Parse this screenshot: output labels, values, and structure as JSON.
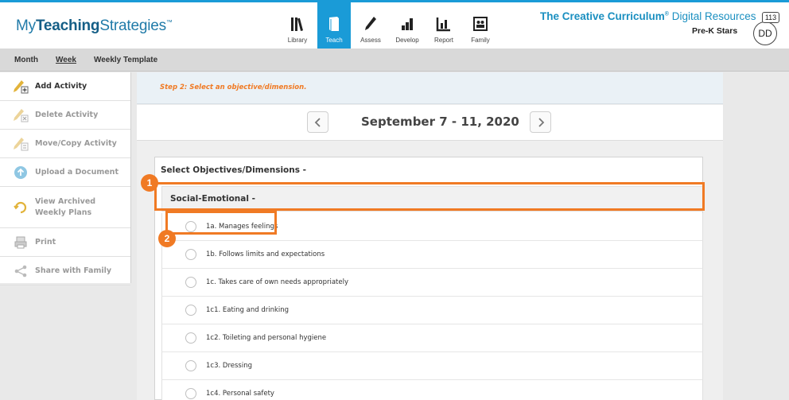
{
  "header": {
    "logo_prefix": "My",
    "logo_bold": "Teaching",
    "logo_suffix": "Strategies",
    "logo_tm": "™",
    "nav": [
      {
        "label": "Library",
        "icon": "library-icon"
      },
      {
        "label": "Teach",
        "icon": "teach-icon"
      },
      {
        "label": "Assess",
        "icon": "assess-icon"
      },
      {
        "label": "Develop",
        "icon": "develop-icon"
      },
      {
        "label": "Report",
        "icon": "report-icon"
      },
      {
        "label": "Family",
        "icon": "family-icon"
      }
    ],
    "active_nav": "Teach",
    "brand_bold": "The Creative Curriculum",
    "brand_reg": "®",
    "brand_light": " Digital Resources",
    "class_name": "Pre-K Stars",
    "avatar_initials": "DD",
    "notification_count": "113"
  },
  "subnav": {
    "items": [
      "Month",
      "Week",
      "Weekly Template"
    ],
    "selected": "Week"
  },
  "sidebar": {
    "items": [
      {
        "label": "Add Activity",
        "icon": "add-activity-icon",
        "enabled": true
      },
      {
        "label": "Delete Activity",
        "icon": "delete-activity-icon",
        "enabled": false
      },
      {
        "label": "Move/Copy Activity",
        "icon": "move-copy-icon",
        "enabled": false
      },
      {
        "label": "Upload a Document",
        "icon": "upload-icon",
        "enabled": false
      },
      {
        "label": "View Archived Weekly Plans",
        "icon": "archive-icon",
        "enabled": false
      },
      {
        "label": "Print",
        "icon": "print-icon",
        "enabled": false
      },
      {
        "label": "Share with Family",
        "icon": "share-icon",
        "enabled": false
      }
    ]
  },
  "main": {
    "step_text": "Step 2: Select an objective/dimension.",
    "date_range": "September 7 - 11, 2020",
    "panel_title": "Select Objectives/Dimensions  -",
    "domain_title": "Social-Emotional  -",
    "objectives": [
      "1a. Manages feelings",
      "1b. Follows limits and expectations",
      "1c. Takes care of own needs appropriately",
      "1c1. Eating and drinking",
      "1c2. Toileting and personal hygiene",
      "1c3. Dressing",
      "1c4. Personal safety"
    ]
  },
  "callouts": [
    "1",
    "2"
  ],
  "colors": {
    "accent": "#1a9bd7",
    "callout": "#f07a24",
    "brand_text": "#1a8fc0"
  }
}
